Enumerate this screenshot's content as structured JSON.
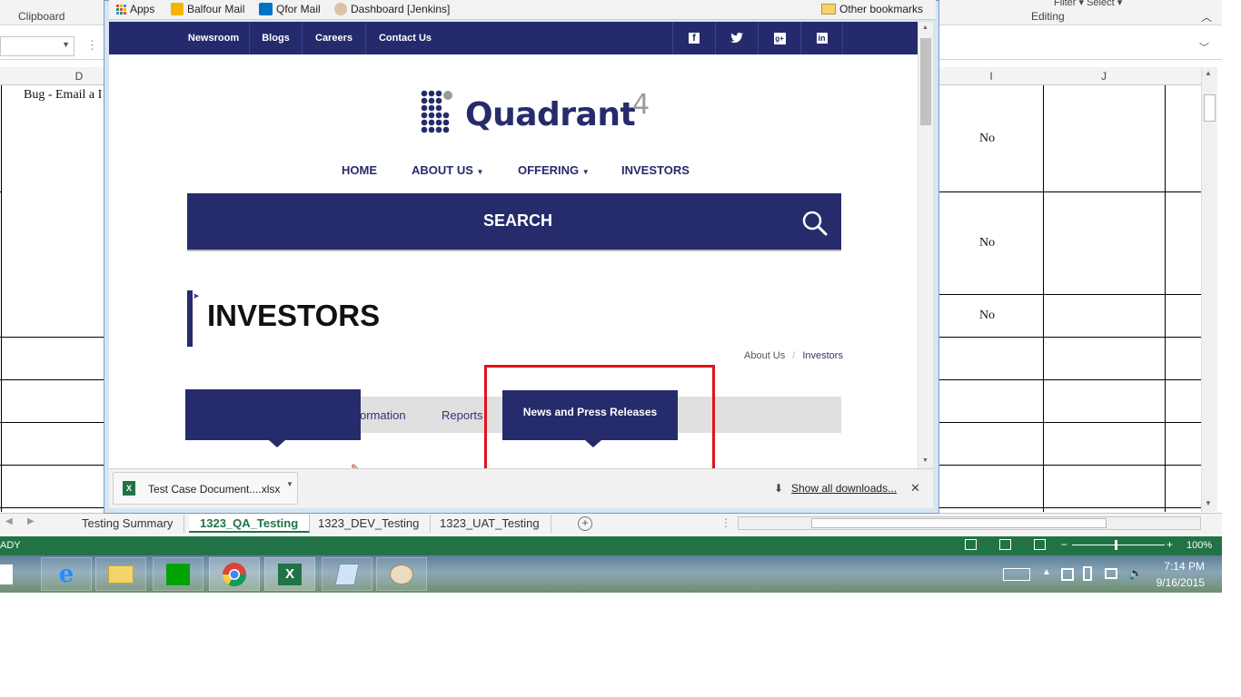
{
  "excel": {
    "ribbon": {
      "clipboard_label": "Clipboard",
      "editing_label": "Editing",
      "filter_select_label": "Filter ▾ Select ▾"
    },
    "columns": {
      "d": "D",
      "i": "I",
      "j": "J"
    },
    "cells": {
      "d1": "Bug - Email a I",
      "i1": "No",
      "i2": "No",
      "i3": "No"
    },
    "sheet_tabs": [
      "Testing Summary",
      "1323_QA_Testing",
      "1323_DEV_Testing",
      "1323_UAT_Testing"
    ],
    "status": {
      "ready": "ADY",
      "zoom": "100%"
    }
  },
  "taskbar": {
    "time": "7:14 PM",
    "date": "9/16/2015"
  },
  "browser": {
    "bookmarks": {
      "apps": "Apps",
      "balfour": "Balfour Mail",
      "qfor": "Qfor Mail",
      "jenkins": "Dashboard [Jenkins]",
      "other": "Other bookmarks"
    },
    "downloads": {
      "file": "Test Case Document....xlsx",
      "show_all": "Show all downloads..."
    }
  },
  "site": {
    "topnav": [
      "Newsroom",
      "Blogs",
      "Careers",
      "Contact Us"
    ],
    "logo": {
      "text": "Quadrant",
      "sup": "4"
    },
    "mainnav": {
      "home": "HOME",
      "about": "ABOUT US",
      "offering": "OFFERING",
      "investors": "INVESTORS"
    },
    "search_label": "SEARCH",
    "page_title": "INVESTORS",
    "breadcrumb": {
      "parent": "About Us",
      "sep": "/",
      "current": "Investors"
    },
    "tabs": {
      "information": "ormation",
      "reports": "Reports",
      "news": "News and Press Releases"
    }
  },
  "colors": {
    "brand_navy": "#262b6b",
    "excel_green": "#217346",
    "highlight_red": "#e0141e"
  }
}
